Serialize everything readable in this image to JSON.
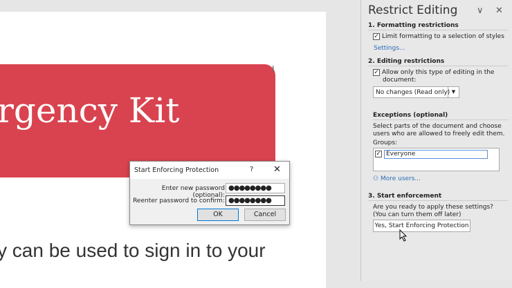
{
  "document": {
    "banner_text": "rgency Kit",
    "body_text": "y can be used to sign in to your",
    "banner_color": "#d9434f"
  },
  "dialog": {
    "title": "Start Enforcing Protection",
    "help": "?",
    "close": "✕",
    "new_password_label": "Enter new password (optional):",
    "new_password_value": "●●●●●●●●",
    "confirm_label": "Reenter password to confirm:",
    "confirm_value": "●●●●●●●●",
    "ok": "OK",
    "cancel": "Cancel"
  },
  "panel": {
    "title": "Restrict Editing",
    "collapse": "∨",
    "close": "✕",
    "sec1": "1. Formatting restrictions",
    "limit_formatting": "Limit formatting to a selection of styles",
    "settings_link": "Settings...",
    "sec2": "2. Editing restrictions",
    "allow_only": "Allow only this type of editing in the document:",
    "editing_type": "No changes (Read only)",
    "exceptions": "Exceptions (optional)",
    "exceptions_desc": "Select parts of the document and choose users who are allowed to freely edit them.",
    "groups_label": "Groups:",
    "group_everyone": "Everyone",
    "more_users": "More users...",
    "sec3": "3. Start enforcement",
    "enforce_desc": "Are you ready to apply these settings? (You can turn them off later)",
    "enforce_button": "Yes, Start Enforcing Protection"
  }
}
